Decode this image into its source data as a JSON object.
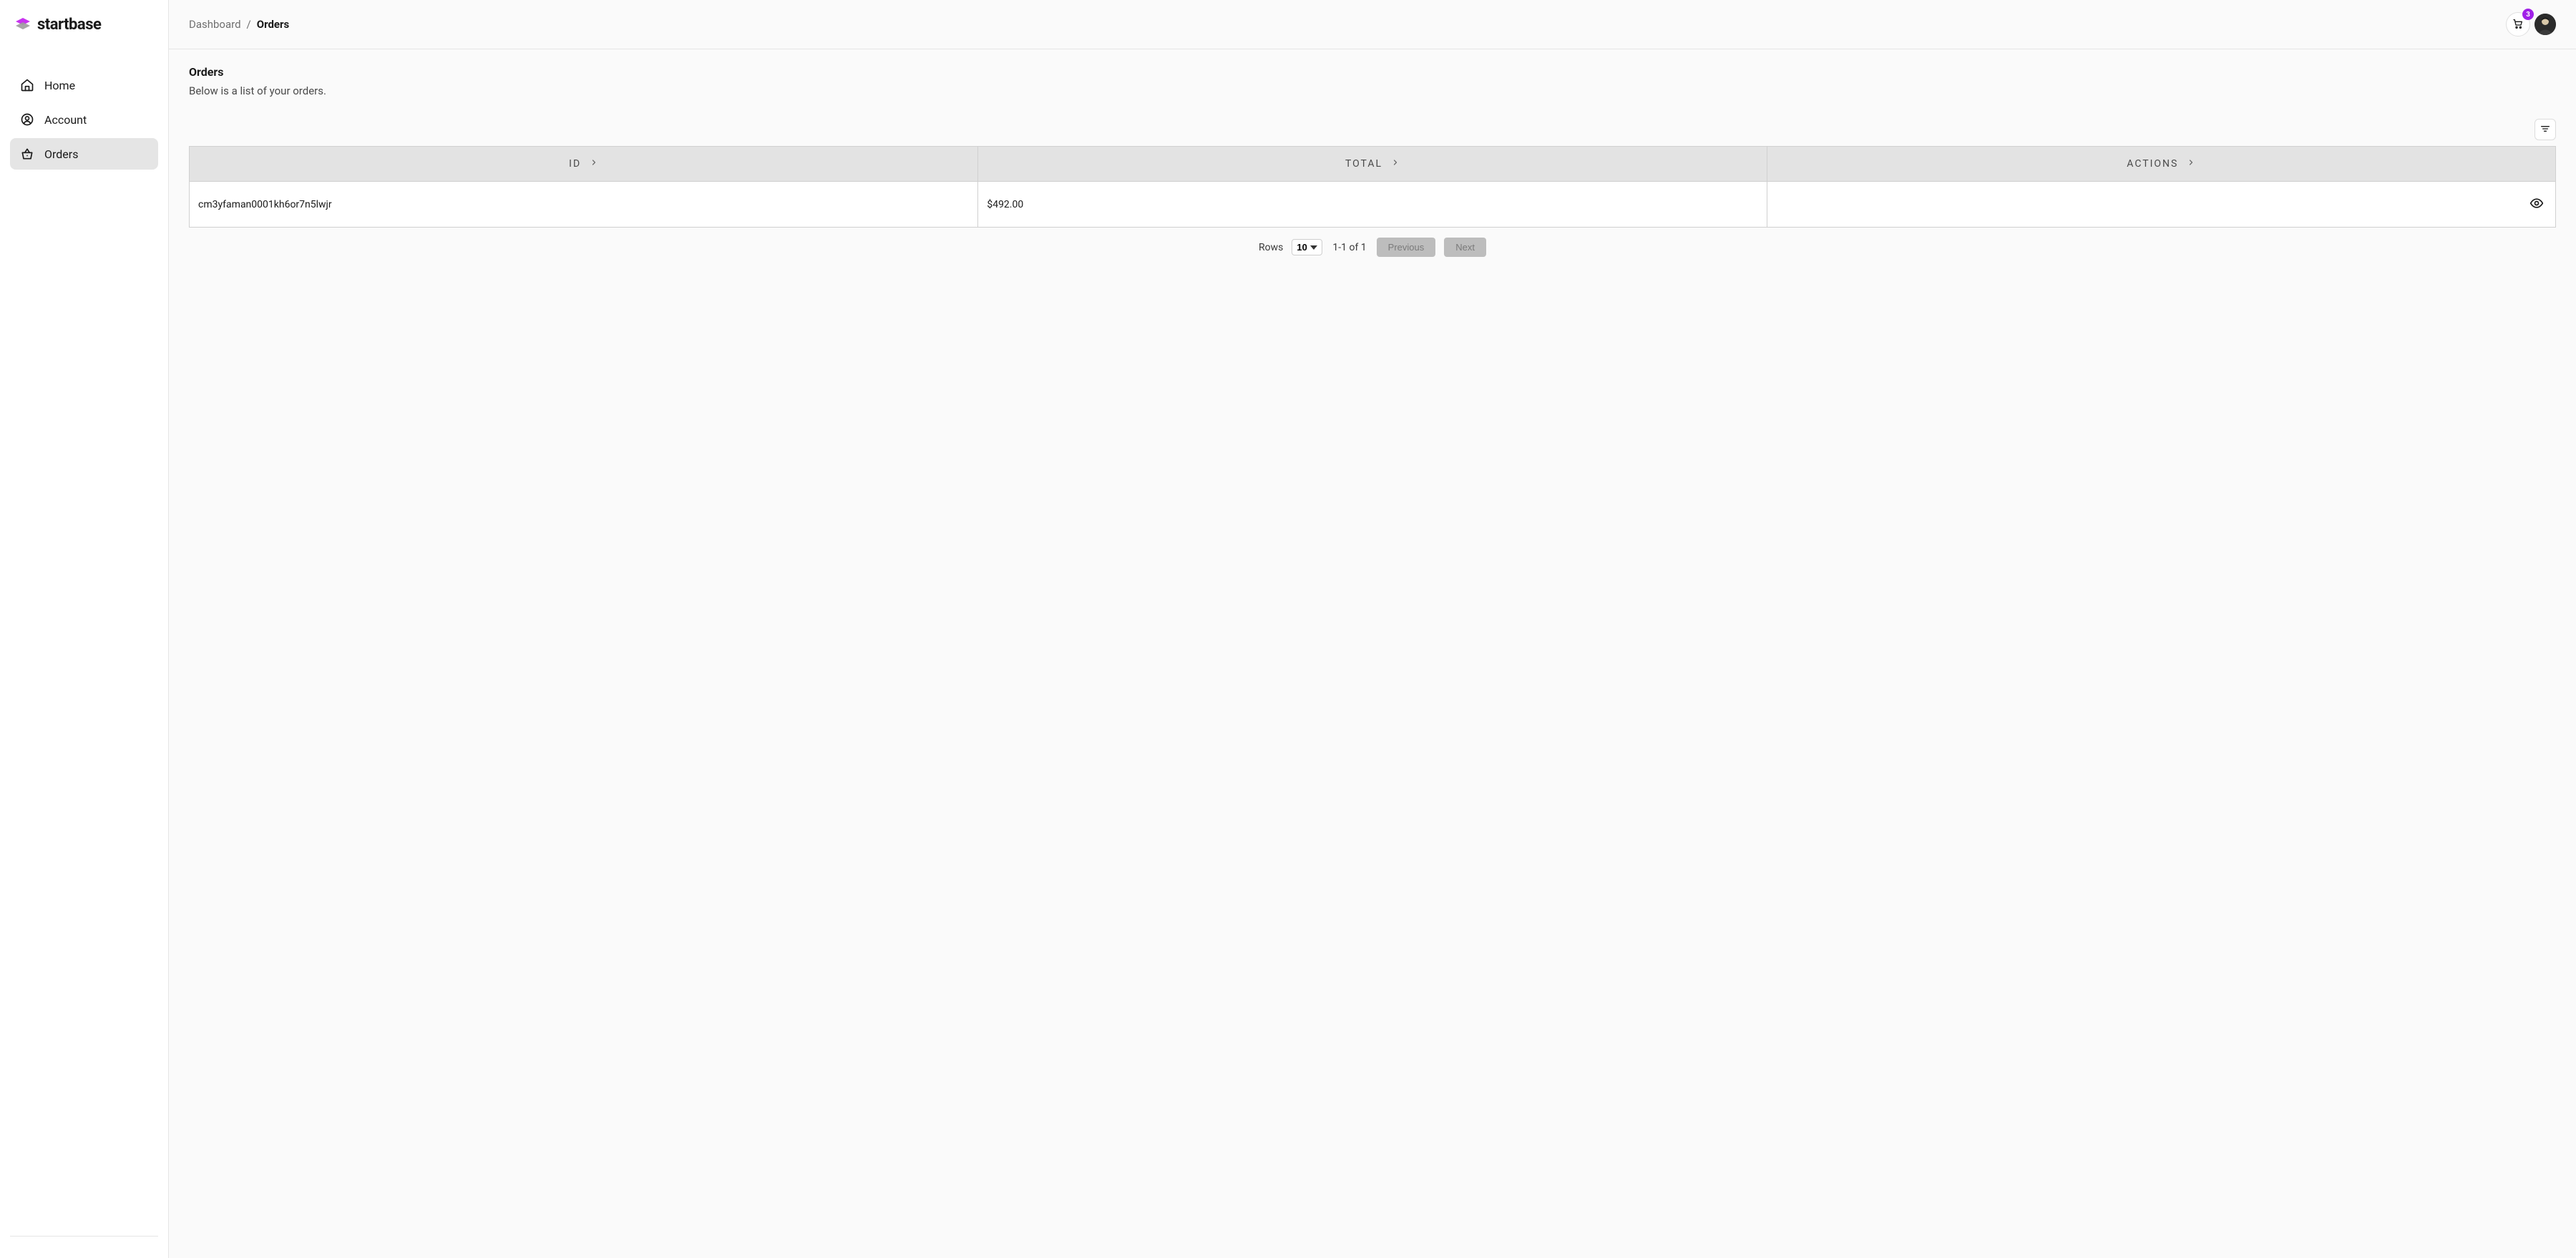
{
  "brand": {
    "name": "startbase"
  },
  "sidebar": {
    "items": [
      {
        "label": "Home",
        "icon": "home-icon",
        "active": false
      },
      {
        "label": "Account",
        "icon": "account-icon",
        "active": false
      },
      {
        "label": "Orders",
        "icon": "basket-icon",
        "active": true
      }
    ]
  },
  "breadcrumb": {
    "parent": "Dashboard",
    "separator": "/",
    "current": "Orders"
  },
  "cart": {
    "badge": "3"
  },
  "page": {
    "title": "Orders",
    "subtitle": "Below is a list of your orders."
  },
  "table": {
    "columns": {
      "id": "ID",
      "total": "TOTAL",
      "actions": "ACTIONS"
    },
    "rows": [
      {
        "id": "cm3yfaman0001kh6or7n5lwjr",
        "total": "$492.00"
      }
    ]
  },
  "pagination": {
    "rows_label": "Rows",
    "rows_value": "10",
    "range": "1-1 of 1",
    "prev_label": "Previous",
    "next_label": "Next"
  }
}
